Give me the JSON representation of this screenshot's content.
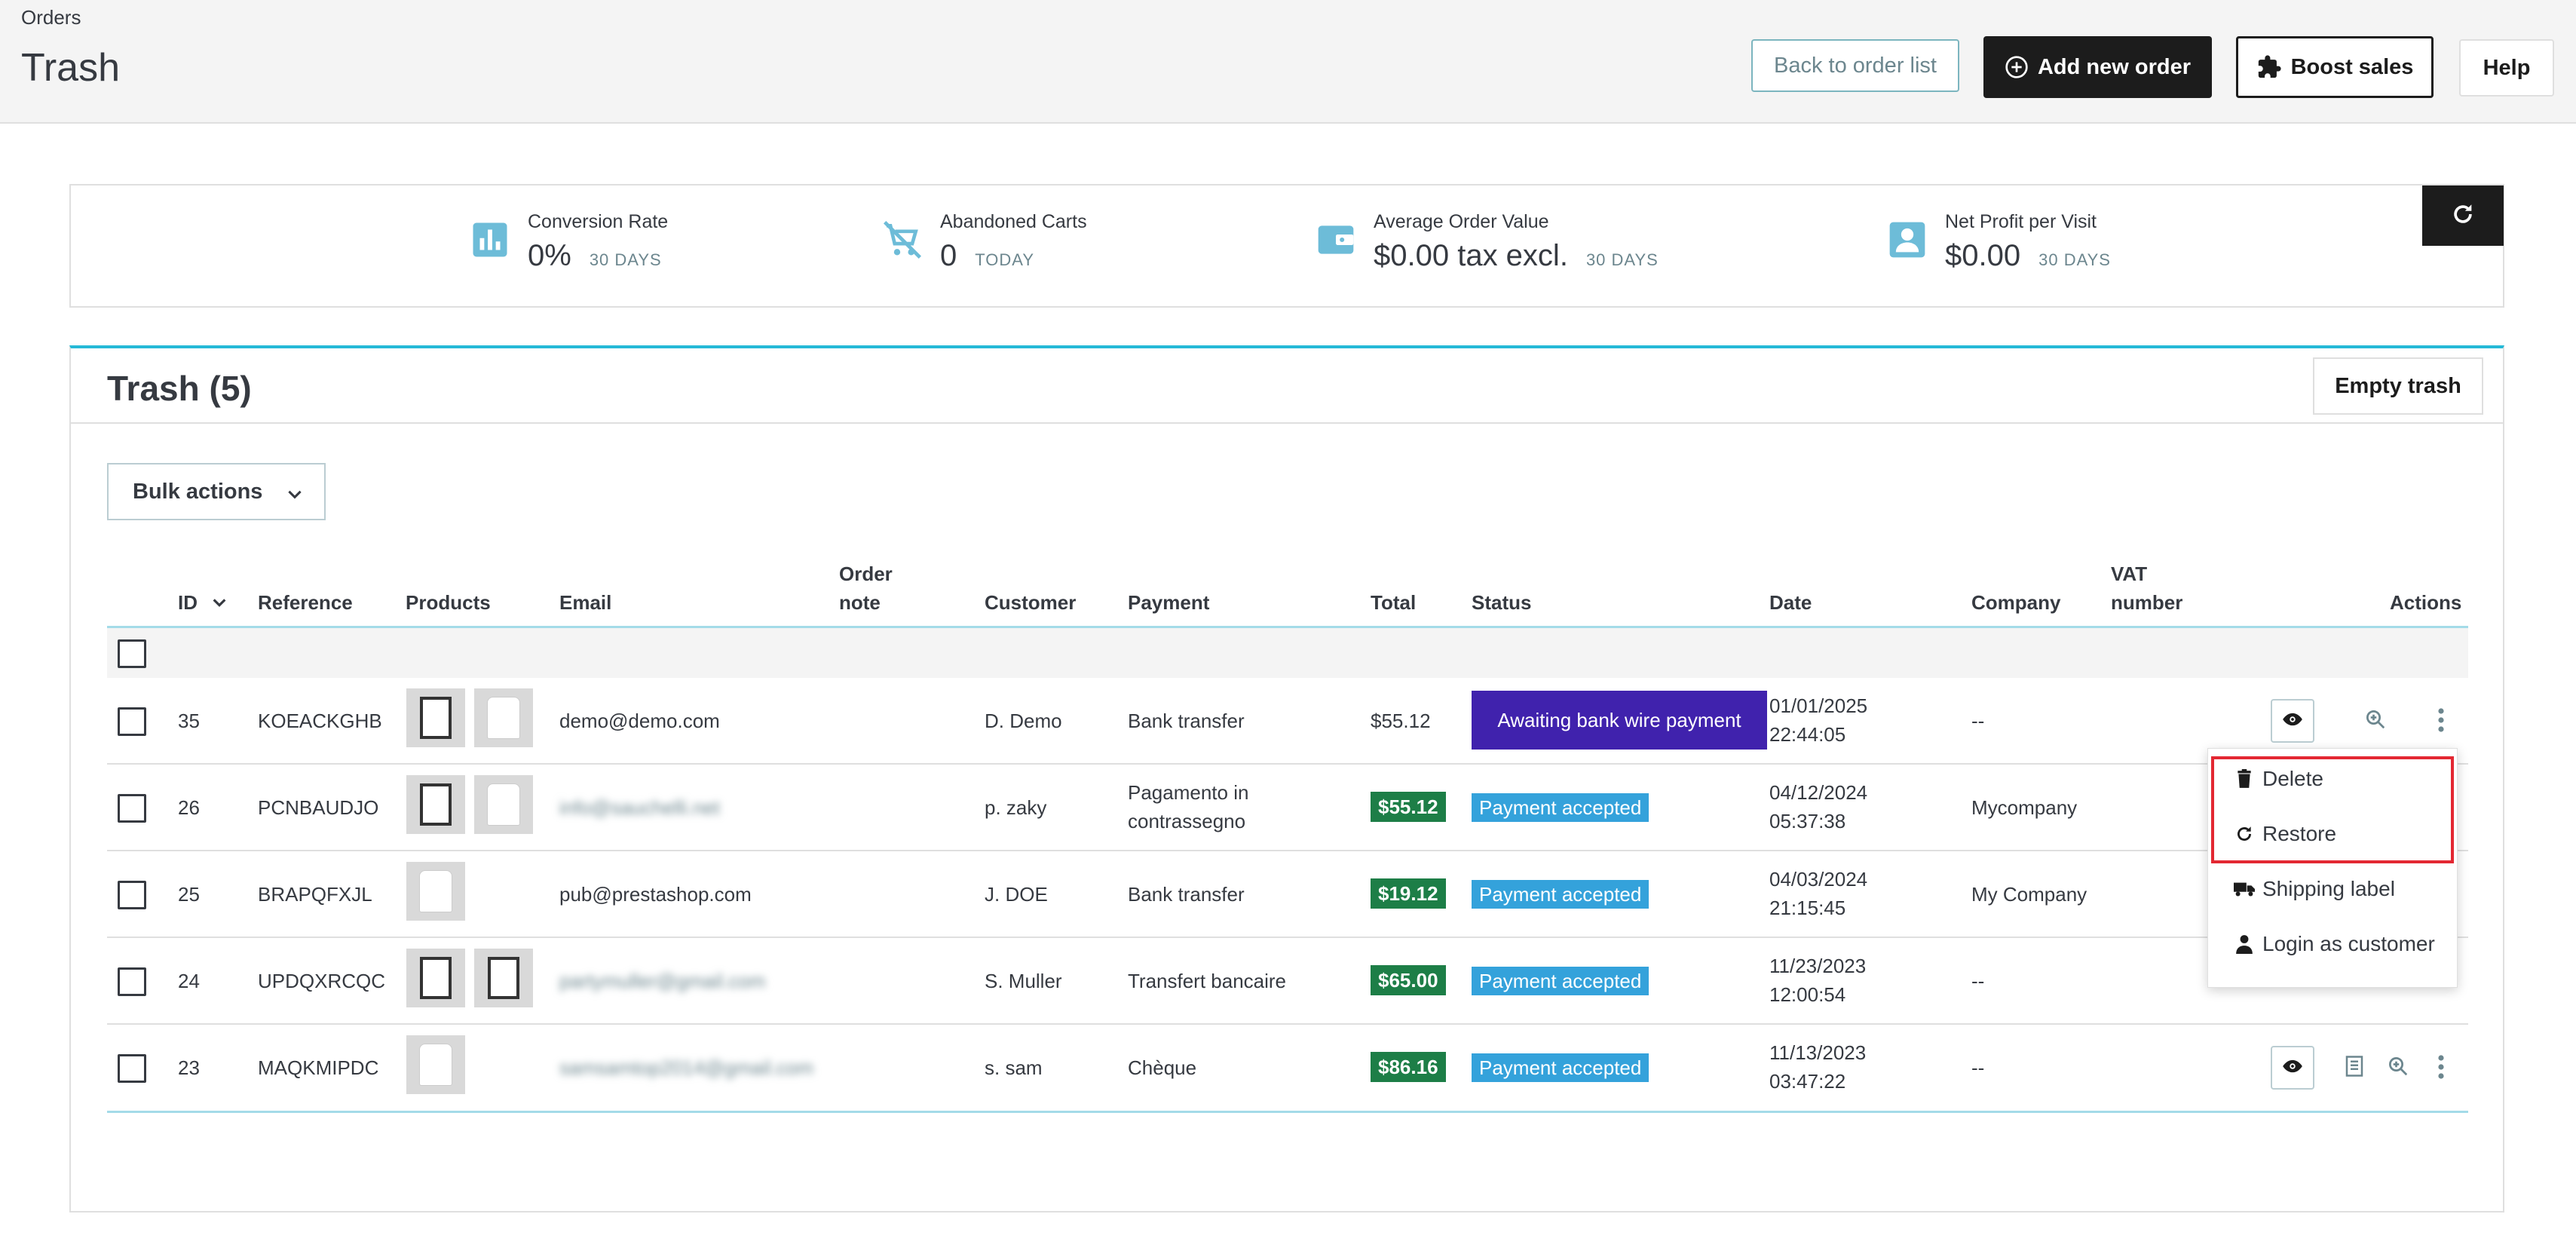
{
  "header": {
    "breadcrumb": "Orders",
    "title": "Trash",
    "back_label": "Back to order list",
    "add_label": "Add new order",
    "boost_label": "Boost sales",
    "help_label": "Help"
  },
  "kpis": [
    {
      "label": "Conversion Rate",
      "value": "0%",
      "period": "30 DAYS",
      "icon": "bar-chart-icon"
    },
    {
      "label": "Abandoned Carts",
      "value": "0",
      "period": "TODAY",
      "icon": "cart-off-icon"
    },
    {
      "label": "Average Order Value",
      "value": "$0.00 tax excl.",
      "period": "30 DAYS",
      "icon": "wallet-icon"
    },
    {
      "label": "Net Profit per Visit",
      "value": "$0.00",
      "period": "30 DAYS",
      "icon": "account-icon"
    }
  ],
  "card": {
    "title": "Trash (5)",
    "empty_label": "Empty trash",
    "bulk_label": "Bulk actions"
  },
  "columns": {
    "id": "ID",
    "reference": "Reference",
    "products": "Products",
    "email": "Email",
    "order_note_1": "Order",
    "order_note_2": "note",
    "customer": "Customer",
    "payment": "Payment",
    "total": "Total",
    "status": "Status",
    "date": "Date",
    "company": "Company",
    "vat_1": "VAT",
    "vat_2": "number",
    "actions": "Actions"
  },
  "rows": [
    {
      "id": "35",
      "reference": "KOEACKGHB",
      "email": "demo@demo.com",
      "customer": "D. Demo",
      "payment_1": "Bank transfer",
      "payment_2": "",
      "total": "$55.12",
      "status": "Awaiting bank wire payment",
      "date_1": "01/01/2025",
      "date_2": "22:44:05",
      "company": "--"
    },
    {
      "id": "26",
      "reference": "PCNBAUDJO",
      "email": "info@sauchelli.net",
      "customer": "p. zaky",
      "payment_1": "Pagamento in",
      "payment_2": "contrassegno",
      "total": "$55.12",
      "status": "Payment accepted",
      "date_1": "04/12/2024",
      "date_2": "05:37:38",
      "company": "Mycompany"
    },
    {
      "id": "25",
      "reference": "BRAPQFXJL",
      "email": "pub@prestashop.com",
      "customer": "J. DOE",
      "payment_1": "Bank transfer",
      "payment_2": "",
      "total": "$19.12",
      "status": "Payment accepted",
      "date_1": "04/03/2024",
      "date_2": "21:15:45",
      "company": "My Company"
    },
    {
      "id": "24",
      "reference": "UPDQXRCQC",
      "email": "partymuller@gmail.com",
      "customer": "S. Muller",
      "payment_1": "Transfert bancaire",
      "payment_2": "",
      "total": "$65.00",
      "status": "Payment accepted",
      "date_1": "11/23/2023",
      "date_2": "12:00:54",
      "company": "--"
    },
    {
      "id": "23",
      "reference": "MAQKMIPDC",
      "email": "samsamtop2014@gmail.com",
      "customer": "s. sam",
      "payment_1": "Chèque",
      "payment_2": "",
      "total": "$86.16",
      "status": "Payment accepted",
      "date_1": "11/13/2023",
      "date_2": "03:47:22",
      "company": "--"
    }
  ],
  "dropdown": {
    "delete_label": "Delete",
    "restore_label": "Restore",
    "shipping_label": "Shipping label",
    "login_label": "Login as customer"
  },
  "colors": {
    "accent": "#25b9d7",
    "total_badge": "#1d7e47",
    "status_accepted": "#34a2db",
    "status_awaiting": "#4022ad",
    "highlight": "#e32832"
  }
}
